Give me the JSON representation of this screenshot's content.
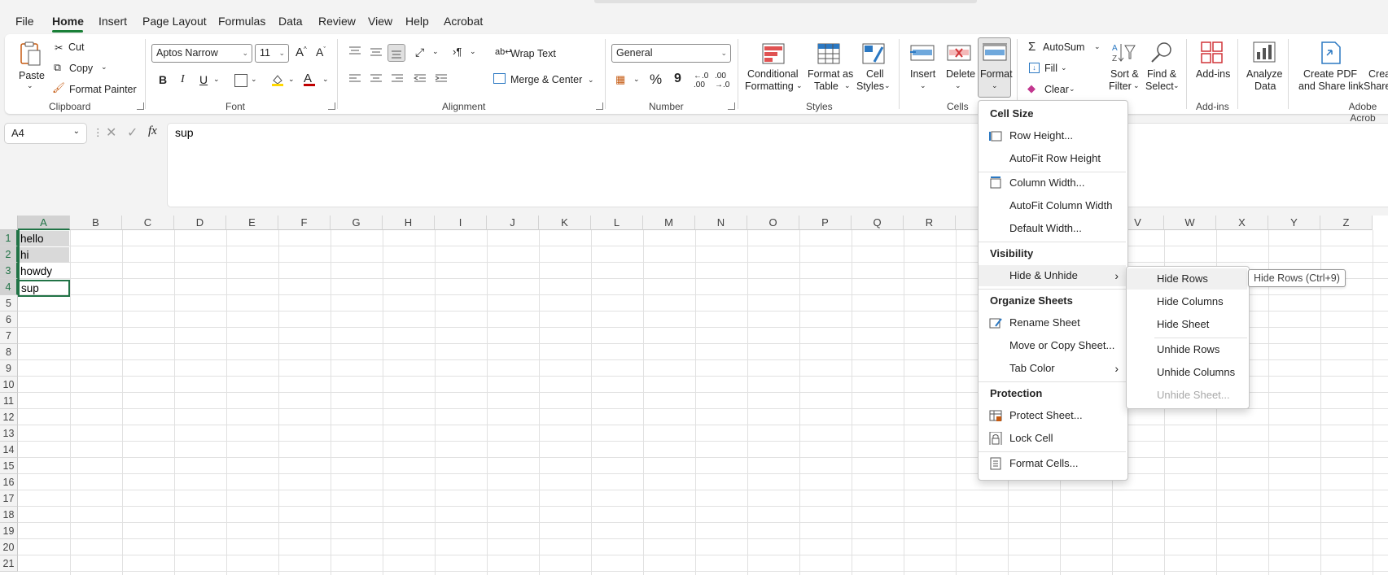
{
  "menubar": [
    "File",
    "Home",
    "Insert",
    "Page Layout",
    "Formulas",
    "Data",
    "Review",
    "View",
    "Help",
    "Acrobat"
  ],
  "ribbon": {
    "clipboard": {
      "paste": "Paste",
      "cut": "Cut",
      "copy": "Copy",
      "format_painter": "Format Painter",
      "label": "Clipboard"
    },
    "font": {
      "name": "Aptos Narrow",
      "size": "11",
      "label": "Font",
      "bold": "B",
      "italic": "I",
      "underline": "U"
    },
    "alignment": {
      "wrap": "Wrap Text",
      "merge": "Merge & Center",
      "label": "Alignment"
    },
    "number": {
      "format": "General",
      "percent": "%",
      "comma": "9",
      "label": "Number"
    },
    "styles": {
      "conditional_1": "Conditional",
      "conditional_2": "Formatting",
      "format_table_1": "Format as",
      "format_table_2": "Table",
      "cell_styles_1": "Cell",
      "cell_styles_2": "Styles",
      "label": "Styles"
    },
    "cells": {
      "insert": "Insert",
      "delete": "Delete",
      "format": "Format",
      "label": "Cells"
    },
    "editing": {
      "autosum": "AutoSum",
      "fill": "Fill",
      "clear": "Clear",
      "sort_1": "Sort &",
      "sort_2": "Filter",
      "find_1": "Find &",
      "find_2": "Select"
    },
    "addins": {
      "addins": "Add-ins",
      "label": "Add-ins"
    },
    "analyze": {
      "line1": "Analyze",
      "line2": "Data"
    },
    "acrobat": {
      "create_1": "Create PDF",
      "create_2": "and Share link",
      "crea_1": "Crea",
      "crea_2": "Share",
      "label": "Adobe Acrob"
    }
  },
  "formula_bar": {
    "namebox": "A4",
    "fx": "fx",
    "content": "sup"
  },
  "columns": [
    "A",
    "B",
    "C",
    "D",
    "E",
    "F",
    "G",
    "H",
    "I",
    "J",
    "K",
    "L",
    "M",
    "N",
    "O",
    "P",
    "Q",
    "R",
    "V",
    "W",
    "X",
    "Y",
    "Z"
  ],
  "rows": [
    "1",
    "2",
    "3",
    "4",
    "5",
    "6",
    "7",
    "8",
    "9",
    "10",
    "11",
    "12",
    "13",
    "14",
    "15",
    "16",
    "17",
    "18",
    "19",
    "20",
    "21"
  ],
  "cells": {
    "a1": "hello",
    "a2": "hi",
    "a3": "howdy",
    "a4": "sup"
  },
  "format_menu": {
    "cell_size": "Cell Size",
    "row_height": "Row Height...",
    "autofit_row": "AutoFit Row Height",
    "column_width": "Column Width...",
    "autofit_column": "AutoFit Column Width",
    "default_width": "Default Width...",
    "visibility": "Visibility",
    "hide_unhide": "Hide & Unhide",
    "organize": "Organize Sheets",
    "rename": "Rename Sheet",
    "move_copy": "Move or Copy Sheet...",
    "tab_color": "Tab Color",
    "protection": "Protection",
    "protect": "Protect Sheet...",
    "lock": "Lock Cell",
    "format_cells": "Format Cells..."
  },
  "submenu": {
    "hide_rows": "Hide Rows",
    "hide_columns": "Hide Columns",
    "hide_sheet": "Hide Sheet",
    "unhide_rows": "Unhide Rows",
    "unhide_columns": "Unhide Columns",
    "unhide_sheet": "Unhide Sheet..."
  },
  "tooltip": "Hide Rows (Ctrl+9)",
  "colors": {
    "accent": "#1a7f37",
    "selection": "#217346",
    "font_red": "#c00000",
    "highlight": "#ffd800"
  }
}
